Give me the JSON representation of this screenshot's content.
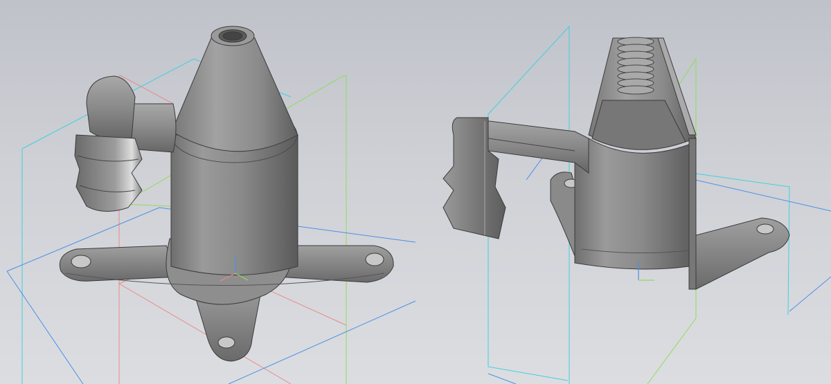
{
  "scene": {
    "background_top": "#bfc2c9",
    "background_bottom": "#dcdde1",
    "part_color": "#8c8c8c",
    "edge_color": "#3c3c3c",
    "plane_colors": {
      "xy_plane": "#4a8fe6",
      "yz_plane": "#3ed0e0",
      "zx_plane": "#e88a8a",
      "aux_plane": "#8fdc5a"
    },
    "views": [
      {
        "name": "full-part-view",
        "features": [
          "cone-top",
          "threaded-hole",
          "cylinder-body",
          "hose-barb",
          "elbow-pipe",
          "four-arm-base",
          "mounting-holes"
        ]
      },
      {
        "name": "section-view",
        "features": [
          "sectioned-cone",
          "internal-thread",
          "sectioned-cylinder",
          "sectioned-hose-barb",
          "sectioned-arm",
          "mounting-holes"
        ]
      }
    ]
  }
}
